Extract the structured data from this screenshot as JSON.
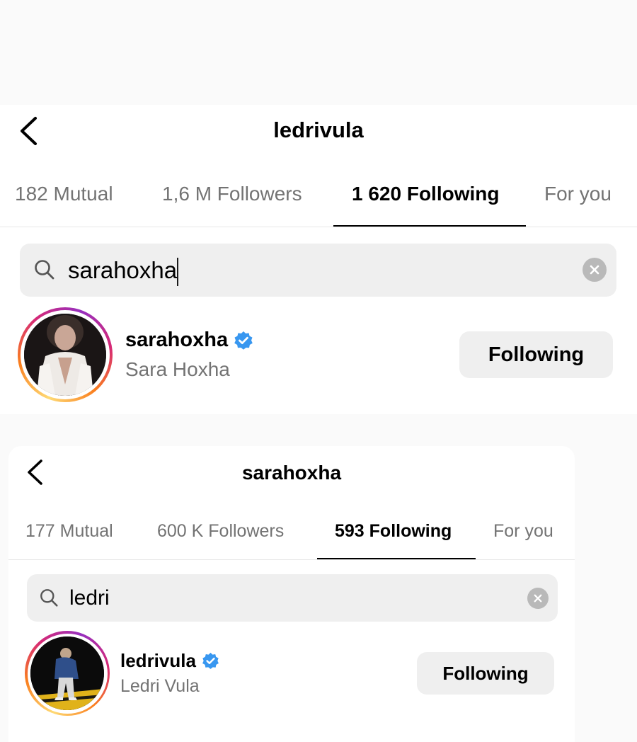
{
  "colors": {
    "background": "#ffffff",
    "search_bg": "#efefef",
    "muted_text": "#737373",
    "verified_blue": "#3897f0",
    "button_bg": "#efefef"
  },
  "screens": [
    {
      "header": {
        "title": "ledrivula",
        "back_icon": "chevron-left-icon"
      },
      "tabs": [
        {
          "label": "182 Mutual",
          "active": false
        },
        {
          "label": "1,6 M Followers",
          "active": false
        },
        {
          "label": "1 620 Following",
          "active": true
        },
        {
          "label": "For you",
          "active": false
        }
      ],
      "search": {
        "value": "sarahoxha",
        "search_icon": "search-icon",
        "clear_icon": "clear-icon"
      },
      "result": {
        "username": "sarahoxha",
        "verified": true,
        "full_name": "Sara Hoxha",
        "button_label": "Following"
      }
    },
    {
      "header": {
        "title": "sarahoxha",
        "back_icon": "chevron-left-icon"
      },
      "tabs": [
        {
          "label": "177 Mutual",
          "active": false
        },
        {
          "label": "600 K Followers",
          "active": false
        },
        {
          "label": "593 Following",
          "active": true
        },
        {
          "label": "For you",
          "active": false
        }
      ],
      "search": {
        "value": "ledri",
        "search_icon": "search-icon",
        "clear_icon": "clear-icon"
      },
      "result": {
        "username": "ledrivula",
        "verified": true,
        "full_name": "Ledri Vula",
        "button_label": "Following"
      }
    }
  ]
}
